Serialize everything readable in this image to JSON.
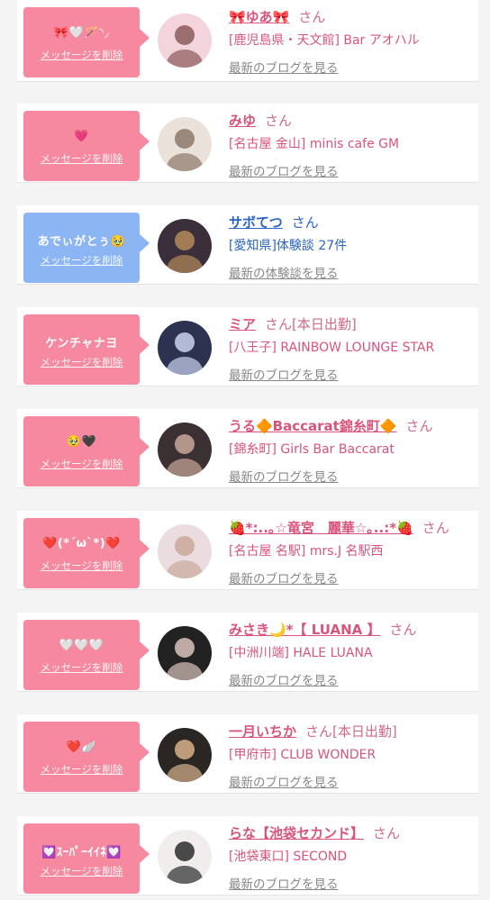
{
  "colors": {
    "pink_button": "#f6899f",
    "blue_button": "#8bb6f3",
    "name_pink": "#d9547a",
    "name_blue": "#2a64c5",
    "shop_pink": "#d9547a",
    "shop_blue": "#2a64c5",
    "blog_gray": "#888888"
  },
  "delete_label": "メッセージを削除",
  "entries": [
    {
      "message": "🎀🤍🪄◝◞",
      "name": "🎀ゆあ🎀",
      "honorific": "さん",
      "status": "",
      "shop": "[鹿児島県・天文館] Bar アオハル",
      "blog": "最新のブログを見る",
      "theme": "pink",
      "avatar_bg": "#f4d4dc",
      "avatar_fg": "#8a5a5a"
    },
    {
      "message": "💗",
      "name": "みゆ",
      "honorific": "さん",
      "status": "",
      "shop": "[名古屋 金山] minis cafe GM",
      "blog": "最新のブログを見る",
      "theme": "pink",
      "avatar_bg": "#e9e1da",
      "avatar_fg": "#8c7868"
    },
    {
      "message": "あでぃがとぅ🥹",
      "name": "サボてつ",
      "honorific": "さん",
      "status": "",
      "shop": "[愛知県]体験談 27件",
      "blog": "最新の体験談を見る",
      "theme": "blue",
      "avatar_bg": "#3a2f3b",
      "avatar_fg": "#b58a5a"
    },
    {
      "message": "ケンチャナヨ",
      "name": "ミア",
      "honorific": "さん",
      "status": "[本日出勤]",
      "shop": "[八王子] RAINBOW LOUNGE STAR",
      "blog": "最新のブログを見る",
      "theme": "pink",
      "avatar_bg": "#2c3250",
      "avatar_fg": "#c9d4ef"
    },
    {
      "message": "🥹🖤",
      "name": "うる🔶Baccarat錦糸町🔶",
      "honorific": "さん",
      "status": "",
      "shop": "[錦糸町] Girls Bar Baccarat",
      "blog": "最新のブログを見る",
      "theme": "pink",
      "avatar_bg": "#3b3032",
      "avatar_fg": "#c9a89a"
    },
    {
      "message": "❤️(*´ω`*)❤️",
      "name": "🍓*:..｡☆竜宮　麗華☆｡..:*🍓",
      "honorific": "さん",
      "status": "",
      "shop": "[名古屋 名駅] mrs.J 名駅西",
      "blog": "最新のブログを見る",
      "theme": "pink",
      "avatar_bg": "#eadcdf",
      "avatar_fg": "#c9a89a"
    },
    {
      "message": "🤍🤍🤍",
      "name": "みさき🌙*【 LUANA 】",
      "honorific": "さん",
      "status": "",
      "shop": "[中洲川端] HALE LUANA",
      "blog": "最新のブログを見る",
      "theme": "pink",
      "avatar_bg": "#222222",
      "avatar_fg": "#d9c3bd"
    },
    {
      "message": "❤️🪽",
      "name": "一月いちか",
      "honorific": "さん",
      "status": "[本日出勤]",
      "shop": "[甲府市] CLUB WONDER",
      "blog": "最新のブログを見る",
      "theme": "pink",
      "avatar_bg": "#2a2624",
      "avatar_fg": "#d8b28a"
    },
    {
      "message": "💟ｽｰﾊﾟｰｲｲﾈ💟",
      "name": "らな【池袋セカンド】",
      "honorific": "さん",
      "status": "",
      "shop": "[池袋東口] SECOND",
      "blog": "最新のブログを見る",
      "theme": "pink",
      "avatar_bg": "#f1eded",
      "avatar_fg": "#2b2b2b"
    }
  ]
}
